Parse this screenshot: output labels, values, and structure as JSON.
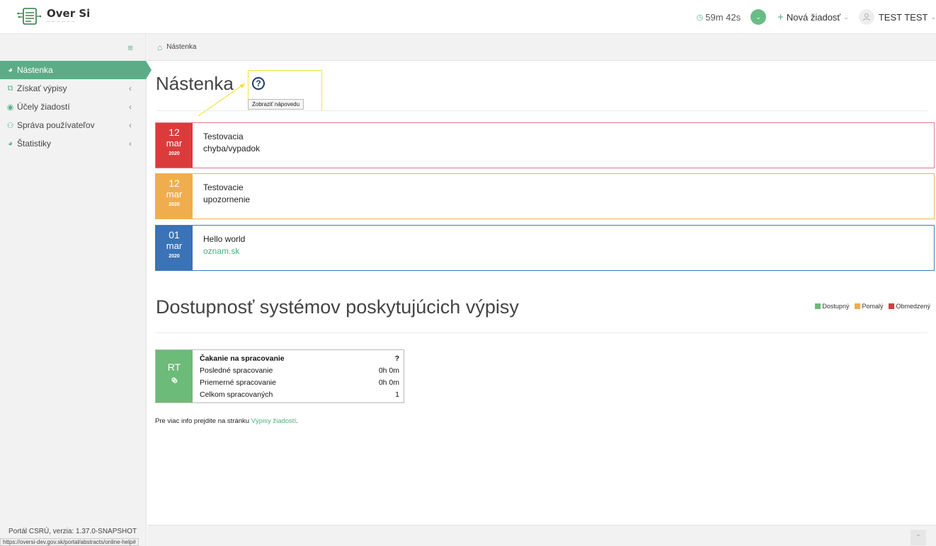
{
  "header": {
    "logo_name": "Over Si",
    "timer": "59m 42s",
    "new_request": "Nová žiadosť",
    "user_name": "TEST TEST"
  },
  "sidebar": {
    "items": [
      {
        "label": "Nástenka",
        "icon": "dashboard-icon",
        "active": true
      },
      {
        "label": "Získať výpisy",
        "icon": "copy-icon"
      },
      {
        "label": "Účely žiadostí",
        "icon": "target-icon"
      },
      {
        "label": "Správa používateľov",
        "icon": "users-icon"
      },
      {
        "label": "Štatistiky",
        "icon": "dashboard-icon"
      }
    ],
    "version": "Portál CSRÚ, verzia: 1.37.0-SNAPSHOT",
    "status_url": "https://oversi-dev.gov.sk/portal/abstracts/online-help#"
  },
  "breadcrumb": {
    "label": "Nástenka"
  },
  "main": {
    "title": "Nástenka",
    "help_tooltip": "Zobraziť nápovedu",
    "notices": [
      {
        "day": "12",
        "month": "mar",
        "year": "2020",
        "line1": "Testovacia",
        "line2": "chyba/vypadok",
        "color": "#dc3b3b"
      },
      {
        "day": "12",
        "month": "mar",
        "year": "2020",
        "line1": "Testovacie",
        "line2": "upozornenie",
        "color": "#f0ad4e"
      },
      {
        "day": "01",
        "month": "mar",
        "year": "2020",
        "line1": "Hello world",
        "line2": "oznam.sk",
        "color": "#3a73b6"
      }
    ],
    "availability_title": "Dostupnosť systémov poskytujúcich výpisy",
    "legend": [
      {
        "label": "Dostupný",
        "color": "#6cbb78"
      },
      {
        "label": "Pomalý",
        "color": "#f0ad4e"
      },
      {
        "label": "Obmedzený",
        "color": "#dc3b3b"
      }
    ],
    "system": {
      "code": "RT",
      "rows": [
        {
          "label": "Čakanie na spracovanie",
          "value": "?"
        },
        {
          "label": "Posledné spracovanie",
          "value": "0h 0m"
        },
        {
          "label": "Priemerné spracovanie",
          "value": "0h 0m"
        },
        {
          "label": "Celkom spracovaných",
          "value": "1"
        }
      ]
    },
    "more_info_prefix": "Pre viac info prejdite na stránku ",
    "more_info_link": "Výpisy žiadostí",
    "more_info_suffix": "."
  }
}
